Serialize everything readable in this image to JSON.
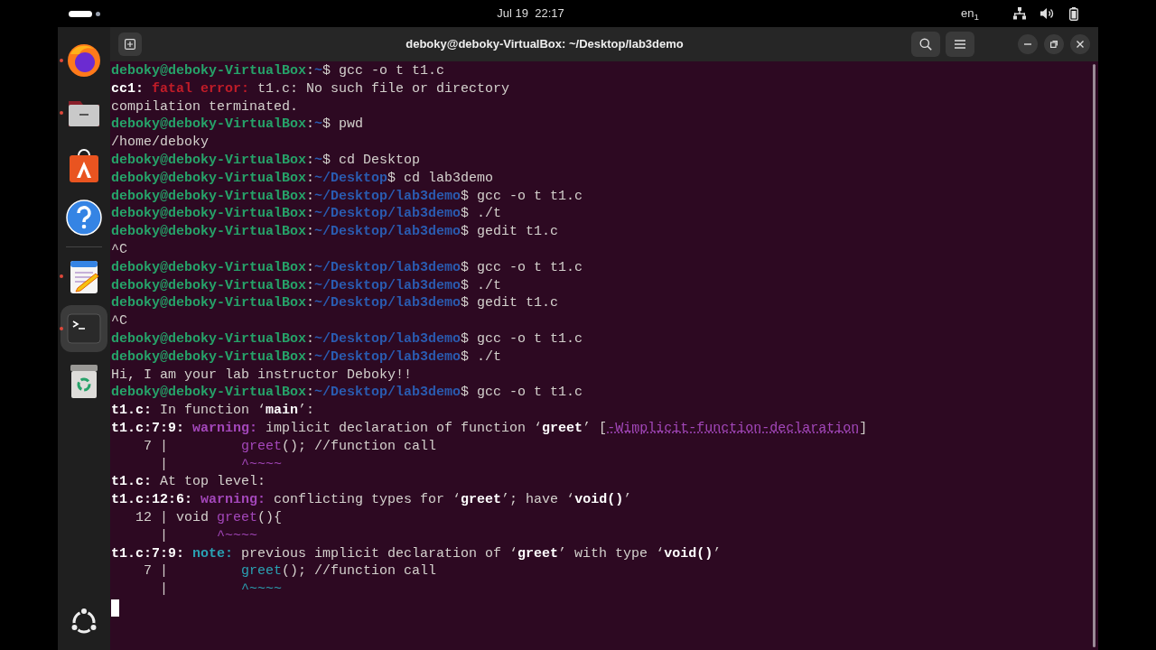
{
  "top_bar": {
    "clock": "Jul 19  22:17",
    "keyboard_layout": "en$_{1}$"
  },
  "dock": {
    "apps": [
      {
        "kind": "browser",
        "running": true,
        "selected": false
      },
      {
        "kind": "files",
        "running": true,
        "selected": false
      },
      {
        "kind": "store",
        "running": false,
        "selected": false
      },
      {
        "kind": "help",
        "running": false,
        "selected": false
      },
      {
        "kind": "editor",
        "running": true,
        "selected": false
      },
      {
        "kind": "terminal",
        "running": true,
        "selected": true
      },
      {
        "kind": "trash",
        "running": false,
        "selected": false
      }
    ]
  },
  "window": {
    "title": "deboky@deboky-VirtualBox: ~/Desktop/lab3demo"
  },
  "terminal": {
    "lines": [
      {
        "kind": "prompt",
        "user": "deboky@deboky-VirtualBox",
        "colon": ":",
        "path": "~",
        "dollar": "$ ",
        "command": "gcc -o t t1.c"
      },
      {
        "kind": "output",
        "segments": [
          {
            "kind": "bold",
            "s": "cc1: "
          },
          {
            "kind": "error",
            "s": "fatal error:"
          },
          {
            "kind": "text",
            "s": " t1.c: No such file or directory"
          }
        ]
      },
      {
        "kind": "output",
        "segments": [
          {
            "kind": "text",
            "s": "compilation terminated."
          }
        ]
      },
      {
        "kind": "prompt",
        "user": "deboky@deboky-VirtualBox",
        "colon": ":",
        "path": "~",
        "dollar": "$ ",
        "command": "pwd"
      },
      {
        "kind": "output",
        "segments": [
          {
            "kind": "text",
            "s": "/home/deboky"
          }
        ]
      },
      {
        "kind": "prompt",
        "user": "deboky@deboky-VirtualBox",
        "colon": ":",
        "path": "~",
        "dollar": "$ ",
        "command": "cd Desktop"
      },
      {
        "kind": "prompt",
        "user": "deboky@deboky-VirtualBox",
        "colon": ":",
        "path": "~/Desktop",
        "dollar": "$ ",
        "command": "cd lab3demo"
      },
      {
        "kind": "prompt",
        "user": "deboky@deboky-VirtualBox",
        "colon": ":",
        "path": "~/Desktop/lab3demo",
        "dollar": "$ ",
        "command": "gcc -o t t1.c"
      },
      {
        "kind": "prompt",
        "user": "deboky@deboky-VirtualBox",
        "colon": ":",
        "path": "~/Desktop/lab3demo",
        "dollar": "$ ",
        "command": "./t"
      },
      {
        "kind": "prompt",
        "user": "deboky@deboky-VirtualBox",
        "colon": ":",
        "path": "~/Desktop/lab3demo",
        "dollar": "$ ",
        "command": "gedit t1.c"
      },
      {
        "kind": "output",
        "segments": [
          {
            "kind": "text",
            "s": "^C"
          }
        ]
      },
      {
        "kind": "prompt",
        "user": "deboky@deboky-VirtualBox",
        "colon": ":",
        "path": "~/Desktop/lab3demo",
        "dollar": "$ ",
        "command": "gcc -o t t1.c"
      },
      {
        "kind": "prompt",
        "user": "deboky@deboky-VirtualBox",
        "colon": ":",
        "path": "~/Desktop/lab3demo",
        "dollar": "$ ",
        "command": "./t"
      },
      {
        "kind": "prompt",
        "user": "deboky@deboky-VirtualBox",
        "colon": ":",
        "path": "~/Desktop/lab3demo",
        "dollar": "$ ",
        "command": "gedit t1.c"
      },
      {
        "kind": "output",
        "segments": [
          {
            "kind": "text",
            "s": "^C"
          }
        ]
      },
      {
        "kind": "prompt",
        "user": "deboky@deboky-VirtualBox",
        "colon": ":",
        "path": "~/Desktop/lab3demo",
        "dollar": "$ ",
        "command": "gcc -o t t1.c"
      },
      {
        "kind": "prompt",
        "user": "deboky@deboky-VirtualBox",
        "colon": ":",
        "path": "~/Desktop/lab3demo",
        "dollar": "$ ",
        "command": "./t"
      },
      {
        "kind": "output",
        "segments": [
          {
            "kind": "text",
            "s": "Hi, I am your lab instructor Deboky!!"
          }
        ]
      },
      {
        "kind": "prompt",
        "user": "deboky@deboky-VirtualBox",
        "colon": ":",
        "path": "~/Desktop/lab3demo",
        "dollar": "$ ",
        "command": "gcc -o t t1.c"
      },
      {
        "kind": "output",
        "segments": [
          {
            "kind": "bold",
            "s": "t1.c:"
          },
          {
            "kind": "text",
            "s": " In function ‘"
          },
          {
            "kind": "bold",
            "s": "main"
          },
          {
            "kind": "text",
            "s": "’:"
          }
        ]
      },
      {
        "kind": "output",
        "segments": [
          {
            "kind": "bold",
            "s": "t1.c:7:9: "
          },
          {
            "kind": "warning",
            "s": "warning:"
          },
          {
            "kind": "text",
            "s": " implicit declaration of function ‘"
          },
          {
            "kind": "bold",
            "s": "greet"
          },
          {
            "kind": "text",
            "s": "’ ["
          },
          {
            "kind": "link",
            "s": "-Wimplicit-function-declaration"
          },
          {
            "kind": "text",
            "s": "]"
          }
        ]
      },
      {
        "kind": "output",
        "segments": [
          {
            "kind": "text",
            "s": "    7 |         "
          },
          {
            "kind": "magenta",
            "s": "greet"
          },
          {
            "kind": "text",
            "s": "(); //function call"
          }
        ]
      },
      {
        "kind": "output",
        "segments": [
          {
            "kind": "text",
            "s": "      |         "
          },
          {
            "kind": "magenta",
            "s": "^~~~~"
          }
        ]
      },
      {
        "kind": "output",
        "segments": [
          {
            "kind": "bold",
            "s": "t1.c:"
          },
          {
            "kind": "text",
            "s": " At top level:"
          }
        ]
      },
      {
        "kind": "output",
        "segments": [
          {
            "kind": "bold",
            "s": "t1.c:12:6: "
          },
          {
            "kind": "warning",
            "s": "warning:"
          },
          {
            "kind": "text",
            "s": " conflicting types for ‘"
          },
          {
            "kind": "bold",
            "s": "greet"
          },
          {
            "kind": "text",
            "s": "’; have ‘"
          },
          {
            "kind": "bold",
            "s": "void()"
          },
          {
            "kind": "text",
            "s": "’"
          }
        ]
      },
      {
        "kind": "output",
        "segments": [
          {
            "kind": "text",
            "s": "   12 | void "
          },
          {
            "kind": "magenta",
            "s": "greet"
          },
          {
            "kind": "text",
            "s": "(){"
          }
        ]
      },
      {
        "kind": "output",
        "segments": [
          {
            "kind": "text",
            "s": "      |      "
          },
          {
            "kind": "magenta",
            "s": "^~~~~"
          }
        ]
      },
      {
        "kind": "output",
        "segments": [
          {
            "kind": "bold",
            "s": "t1.c:7:9: "
          },
          {
            "kind": "note",
            "s": "note:"
          },
          {
            "kind": "text",
            "s": " previous implicit declaration of ‘"
          },
          {
            "kind": "bold",
            "s": "greet"
          },
          {
            "kind": "text",
            "s": "’ with type ‘"
          },
          {
            "kind": "bold",
            "s": "void()"
          },
          {
            "kind": "text",
            "s": "’"
          }
        ]
      },
      {
        "kind": "output",
        "segments": [
          {
            "kind": "text",
            "s": "    7 |         "
          },
          {
            "kind": "cyan",
            "s": "greet"
          },
          {
            "kind": "text",
            "s": "(); //function call"
          }
        ]
      },
      {
        "kind": "output",
        "segments": [
          {
            "kind": "text",
            "s": "      |         "
          },
          {
            "kind": "cyan",
            "s": "^~~~~"
          }
        ]
      }
    ]
  }
}
